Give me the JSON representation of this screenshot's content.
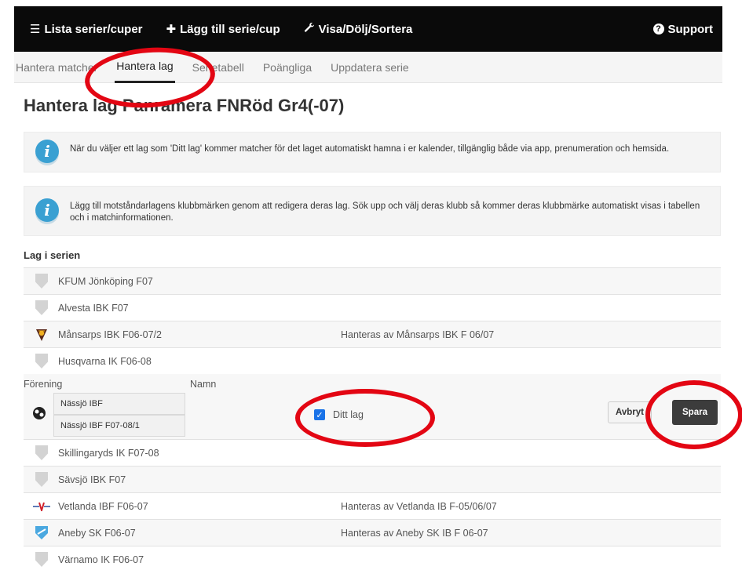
{
  "topbar": {
    "items": [
      {
        "icon": "list-icon",
        "glyph": "☰",
        "label": "Lista serier/cuper"
      },
      {
        "icon": "plus-icon",
        "glyph": "✚",
        "label": "Lägg till serie/cup"
      },
      {
        "icon": "wrench-icon",
        "glyph": "🔧",
        "label": "Visa/Dölj/Sortera"
      }
    ],
    "support": {
      "icon": "question-circle-icon",
      "label": "Support"
    }
  },
  "tabs": [
    {
      "label": "Hantera matcher",
      "active": false
    },
    {
      "label": "Hantera lag",
      "active": true
    },
    {
      "label": "Serietabell",
      "active": false
    },
    {
      "label": "Poängliga",
      "active": false
    },
    {
      "label": "Uppdatera serie",
      "active": false
    }
  ],
  "page_title": "Hantera lag Panramera FNRöd Gr4(-07)",
  "info_boxes": [
    {
      "icon": "info-icon",
      "text": "När du väljer ett lag som 'Ditt lag' kommer matcher för det laget automatiskt hamna i er kalender, tillgänglig både via app, prenumeration och hemsida."
    },
    {
      "icon": "info-icon",
      "text": "Lägg till motståndarlagens klubbmärken genom att redigera deras lag. Sök upp och välj deras klubb så kommer deras klubbmärke automatiskt visas i tabellen och i matchinformationen."
    }
  ],
  "section_title": "Lag i serien",
  "teams_top": [
    {
      "name": "KFUM Jönköping F07",
      "managed": "",
      "badge": "shield-placeholder-icon"
    },
    {
      "name": "Alvesta IBK F07",
      "managed": "",
      "badge": "shield-placeholder-icon"
    },
    {
      "name": "Månsarps IBK F06-07/2",
      "managed": "Hanteras av Månsarps IBK F 06/07",
      "badge": "mansarps-crest-icon"
    },
    {
      "name": "Husqvarna IK F06-08",
      "managed": "",
      "badge": "shield-placeholder-icon"
    }
  ],
  "edit": {
    "forening_label": "Förening",
    "namn_label": "Namn",
    "club_value": "Nässjö IBF",
    "team_value": "Nässjö IBF F07-08/1",
    "checkbox_label": "Ditt lag",
    "checkbox_checked": true,
    "cancel_label": "Avbryt",
    "save_label": "Spara"
  },
  "teams_bottom": [
    {
      "name": "Skillingaryds IK F07-08",
      "managed": "",
      "badge": "shield-placeholder-icon"
    },
    {
      "name": "Sävsjö IBK F07",
      "managed": "",
      "badge": "shield-placeholder-icon"
    },
    {
      "name": "Vetlanda IBF F06-07",
      "managed": "Hanteras av Vetlanda IB F-05/06/07",
      "badge": "vetlanda-crest-icon"
    },
    {
      "name": "Aneby SK F06-07",
      "managed": "Hanteras av Aneby SK IB F 06-07",
      "badge": "aneby-crest-icon"
    },
    {
      "name": "Värnamo IK F06-07",
      "managed": "",
      "badge": "shield-placeholder-icon"
    }
  ],
  "colors": {
    "topbar_bg": "#0a0a0a",
    "info_icon": "#3aa0d2",
    "highlight_ring": "#e30613",
    "save_button": "#3c3c3c",
    "checkbox": "#1a73e8"
  }
}
